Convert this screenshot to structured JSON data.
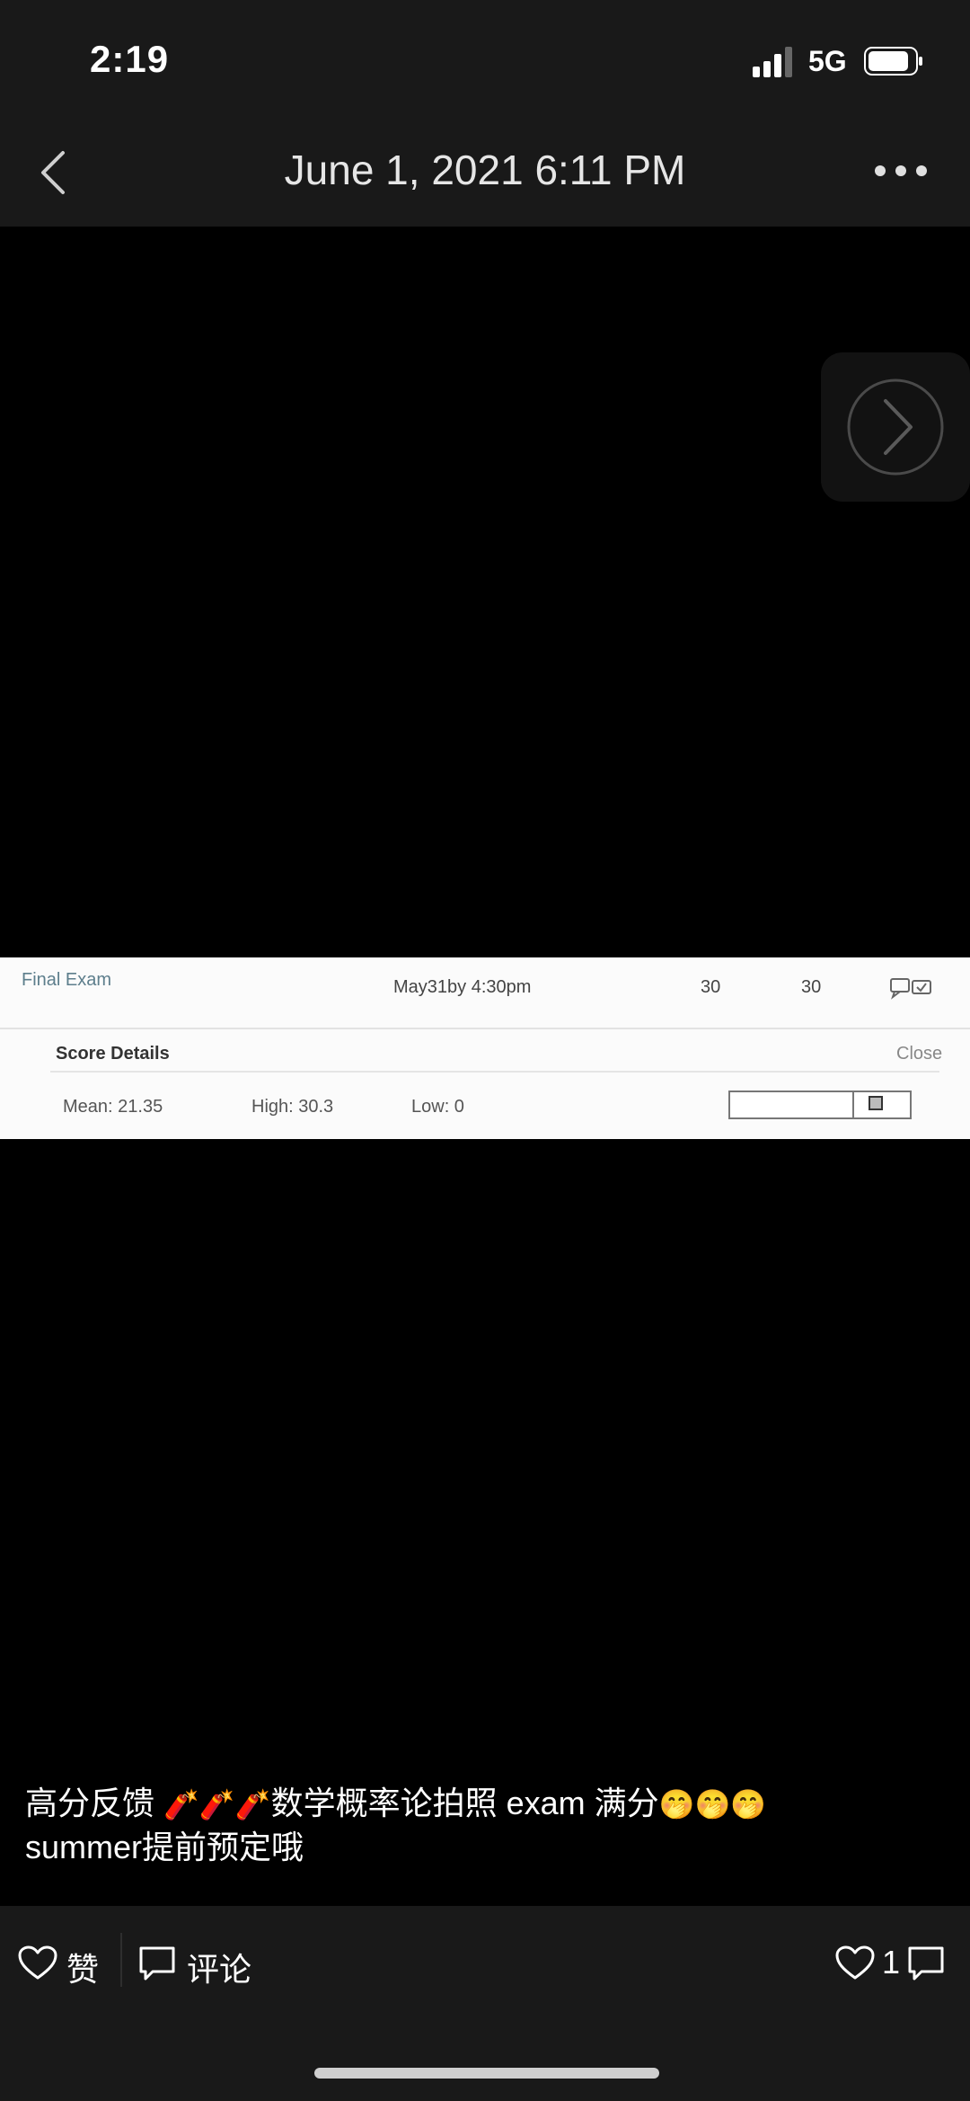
{
  "status_bar": {
    "time": "2:19",
    "network": "5G",
    "icons": [
      "signal-icon",
      "battery-icon"
    ]
  },
  "nav": {
    "title": "June 1, 2021 6:11 PM",
    "icons": [
      "chevron-left-icon",
      "more-dots-icon"
    ]
  },
  "viewer": {
    "next_icon": "chevron-right-circle-icon"
  },
  "photo": {
    "assignment": "Final Exam",
    "due": "May31by 4:30pm",
    "score": "30",
    "out_of": "30",
    "score_details_label": "Score Details",
    "close_label": "Close",
    "mean": "Mean: 21.35",
    "high": "High: 30.3",
    "low": "Low: 0"
  },
  "caption": {
    "line1_a": "高分反馈",
    "emoji_a": "🧨🧨🧨",
    "line1_b": "数学概率论拍照 exam 满分",
    "emoji_b": "🤭🤭🤭",
    "line2": "summer提前预定哦"
  },
  "actions": {
    "like_label": "赞",
    "comment_label": "评论",
    "like_count": "1"
  },
  "colors": {
    "bar_bg": "#191919",
    "viewer_bg": "#000000",
    "text": "#ffffff",
    "photo_bg": "#fbfbfb"
  }
}
